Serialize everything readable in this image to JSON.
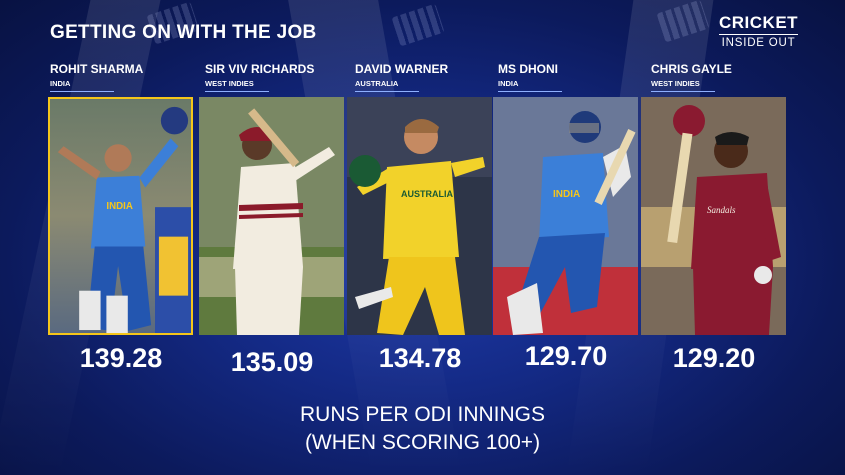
{
  "title": "GETTING ON WITH THE JOB",
  "logo": {
    "line1": "CRICKET",
    "line2": "INSIDE OUT"
  },
  "players": [
    {
      "name": "ROHIT SHARMA",
      "team": "INDIA",
      "value": "139.28",
      "highlighted": true
    },
    {
      "name": "SIR VIV RICHARDS",
      "team": "WEST INDIES",
      "value": "135.09",
      "highlighted": false
    },
    {
      "name": "DAVID WARNER",
      "team": "AUSTRALIA",
      "value": "134.78",
      "highlighted": false
    },
    {
      "name": "MS DHONI",
      "team": "INDIA",
      "value": "129.70",
      "highlighted": false
    },
    {
      "name": "CHRIS GAYLE",
      "team": "WEST INDIES",
      "value": "129.20",
      "highlighted": false
    }
  ],
  "caption": {
    "line1": "RUNS PER ODI INNINGS",
    "line2": "(WHEN SCORING 100+)"
  },
  "colors": {
    "highlight_border": "#f5c61a",
    "background": "#142a86"
  }
}
